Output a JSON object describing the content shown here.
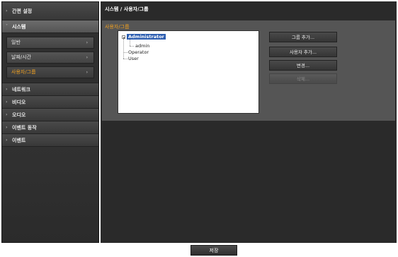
{
  "sidebar": {
    "items": [
      {
        "label": "간편 설정",
        "arrow": "›"
      },
      {
        "label": "시스템",
        "arrow": "˅"
      },
      {
        "label": "네트워크",
        "arrow": "›"
      },
      {
        "label": "비디오",
        "arrow": "›"
      },
      {
        "label": "오디오",
        "arrow": "›"
      },
      {
        "label": "이벤트 동작",
        "arrow": "›"
      },
      {
        "label": "이벤트",
        "arrow": "›"
      }
    ],
    "submenu": [
      {
        "label": "일반",
        "chevron": "›"
      },
      {
        "label": "날짜/시간",
        "chevron": "›"
      },
      {
        "label": "사용자/그룹",
        "chevron": "›"
      }
    ]
  },
  "main": {
    "title": "시스템 / 사용자/그룹",
    "section_title": "사용자/그룹",
    "tree": {
      "root": "Administrator",
      "root_child": "admin",
      "nodes": [
        "Operator",
        "User"
      ]
    },
    "buttons": {
      "add_group": "그룹 추가...",
      "add_user": "사용자 추가...",
      "modify": "변경...",
      "delete": "삭제..."
    }
  },
  "footer": {
    "save_label": "저장"
  },
  "colors": {
    "accent": "#f0a020",
    "selection": "#2c5db0"
  }
}
